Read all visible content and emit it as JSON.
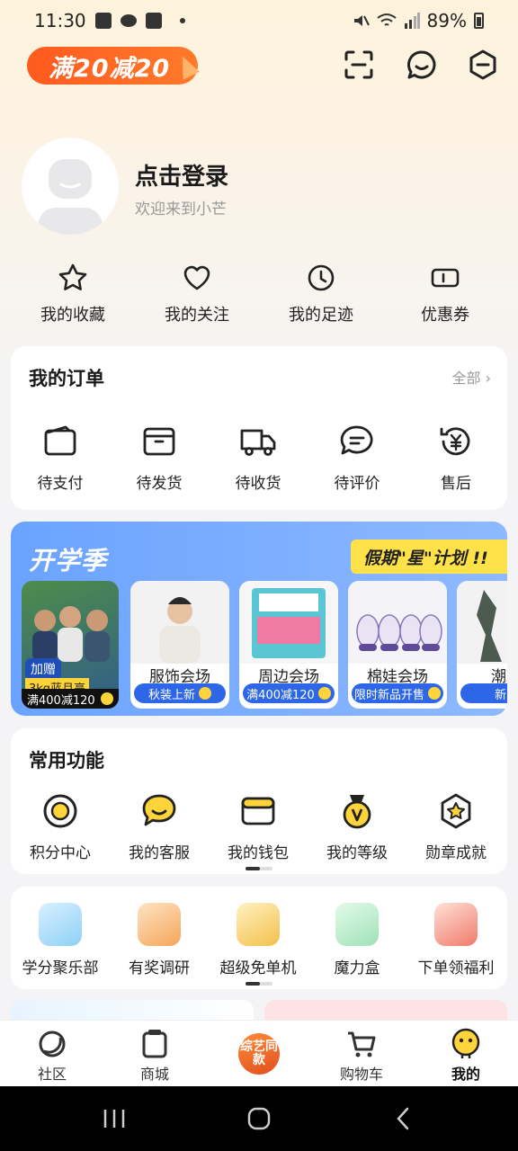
{
  "status_bar": {
    "time": "11:30",
    "battery": "89%"
  },
  "header": {
    "promo": "满20减20"
  },
  "profile": {
    "title": "点击登录",
    "subtitle": "欢迎来到小芒"
  },
  "quick_links": [
    {
      "label": "我的收藏",
      "icon": "star-icon"
    },
    {
      "label": "我的关注",
      "icon": "heart-icon"
    },
    {
      "label": "我的足迹",
      "icon": "clock-icon"
    },
    {
      "label": "优惠券",
      "icon": "coupon-icon"
    }
  ],
  "orders": {
    "title": "我的订单",
    "all_label": "全部 ›",
    "items": [
      {
        "label": "待支付",
        "icon": "wallet-icon"
      },
      {
        "label": "待发货",
        "icon": "box-icon"
      },
      {
        "label": "待收货",
        "icon": "truck-icon"
      },
      {
        "label": "待评价",
        "icon": "comment-icon"
      },
      {
        "label": "售后",
        "icon": "refund-icon"
      }
    ]
  },
  "banner": {
    "season": "开学季",
    "plan": "假期\"星\"计划 !!",
    "first": {
      "gift": "加赠",
      "weight": "3kg蓝月亮",
      "deal": "满400减120"
    },
    "cards": [
      {
        "name": "服饰会场",
        "tag": "秋装上新"
      },
      {
        "name": "周边会场",
        "tag": "满400减120"
      },
      {
        "name": "棉娃会场",
        "tag": "限时新品开售"
      },
      {
        "name": "潮玩",
        "tag": "新品"
      }
    ]
  },
  "functions": {
    "title": "常用功能",
    "items": [
      {
        "label": "积分中心",
        "icon": "points-icon"
      },
      {
        "label": "我的客服",
        "icon": "service-icon"
      },
      {
        "label": "我的钱包",
        "icon": "wallet-icon"
      },
      {
        "label": "我的等级",
        "icon": "level-icon"
      },
      {
        "label": "勋章成就",
        "icon": "medal-icon"
      }
    ]
  },
  "activities": {
    "items": [
      {
        "label": "学分聚乐部",
        "icon": "credit-icon",
        "color": "#5fb8f0"
      },
      {
        "label": "有奖调研",
        "icon": "survey-icon",
        "color": "#f5a55a"
      },
      {
        "label": "超级免单机",
        "icon": "slot-icon",
        "color": "#f3c04a"
      },
      {
        "label": "魔力盒",
        "icon": "magic-box-icon",
        "color": "#57c98a"
      },
      {
        "label": "下单领福利",
        "icon": "gift-icon",
        "color": "#e64a3a"
      }
    ]
  },
  "bottom_nav": {
    "items": [
      {
        "label": "社区",
        "icon": "community-icon"
      },
      {
        "label": "商城",
        "icon": "mall-icon"
      },
      {
        "label": "综艺同款",
        "icon": "variety-icon"
      },
      {
        "label": "购物车",
        "icon": "cart-icon"
      },
      {
        "label": "我的",
        "icon": "me-icon"
      }
    ]
  },
  "colors": {
    "accent": "#ff5a1f",
    "banner": "#6aa3ff",
    "brand_yellow": "#ffd43a"
  }
}
